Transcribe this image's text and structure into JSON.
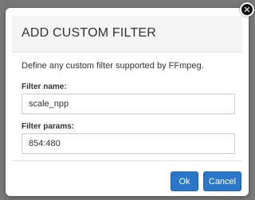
{
  "dialog": {
    "title": "ADD CUSTOM FILTER",
    "description": "Define any custom filter supported by FFmpeg.",
    "fields": [
      {
        "label": "Filter name:",
        "value": "scale_npp"
      },
      {
        "label": "Filter params:",
        "value": "854:480"
      }
    ],
    "ok_label": "Ok",
    "cancel_label": "Cancel",
    "close_icon": "close-icon"
  },
  "colors": {
    "primary_button": "#2a77c9",
    "overlay": "#777777",
    "header_bg": "#f5f5f5"
  }
}
